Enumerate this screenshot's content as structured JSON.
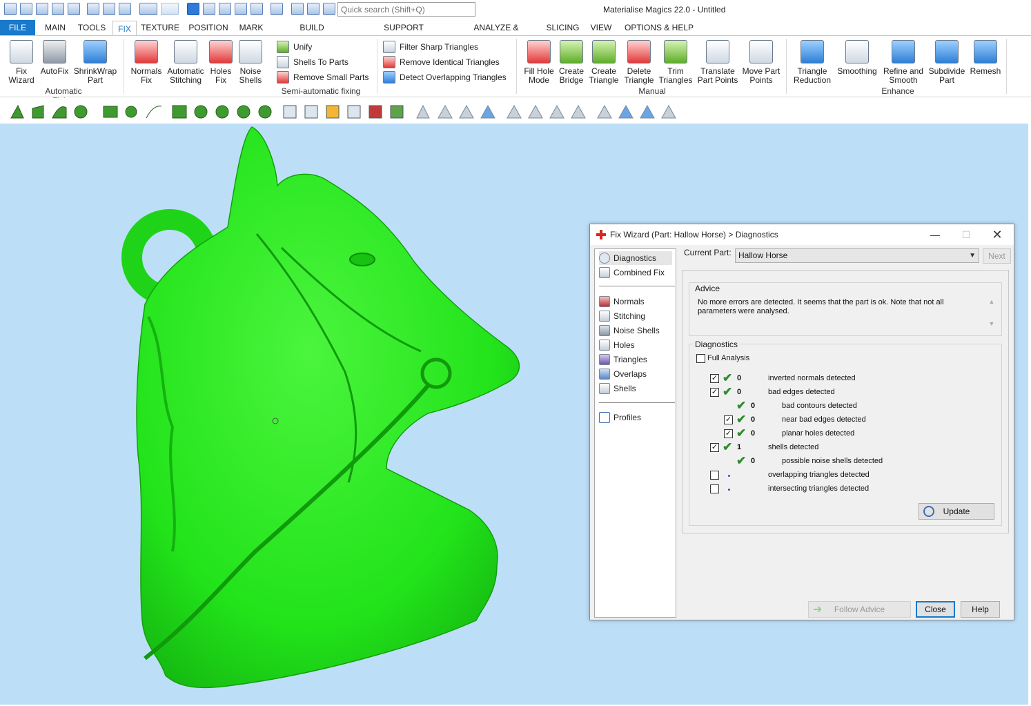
{
  "window": {
    "title": "Materialise Magics 22.0 - Untitled"
  },
  "quick_search": {
    "placeholder": "Quick search (Shift+Q)"
  },
  "menu": {
    "tabs": [
      "FILE",
      "MAIN",
      "TOOLS",
      "FIX",
      "TEXTURE",
      "POSITION",
      "MARK",
      "BUILD PREPARATION",
      "SUPPORT GENERATION",
      "ANALYZE & REPORT",
      "SLICING",
      "VIEW",
      "OPTIONS & HELP"
    ],
    "active": "FIX"
  },
  "ribbon": {
    "automatic_fixing": {
      "label": "Automatic Fixing",
      "buttons": [
        {
          "l1": "Fix",
          "l2": "Wizard",
          "icon": "fix-wizard-icon"
        },
        {
          "l1": "AutoFix",
          "l2": "",
          "icon": "autofix-icon"
        },
        {
          "l1": "ShrinkWrap",
          "l2": "Part",
          "icon": "shrinkwrap-icon"
        }
      ]
    },
    "semi_automatic_fixing": {
      "label": "Semi-automatic fixing",
      "buttons": [
        {
          "l1": "Normals",
          "l2": "Fix",
          "icon": "normals-fix-icon"
        },
        {
          "l1": "Automatic",
          "l2": "Stitching",
          "icon": "stitching-icon"
        },
        {
          "l1": "Holes",
          "l2": "Fix",
          "icon": "holes-fix-icon"
        },
        {
          "l1": "Noise",
          "l2": "Shells",
          "icon": "noise-shells-icon"
        }
      ],
      "small": [
        "Unify",
        "Shells To Parts",
        "Remove Small Parts"
      ],
      "small2": [
        "Filter Sharp Triangles",
        "Remove Identical Triangles",
        "Detect Overlapping Triangles"
      ]
    },
    "manual": {
      "label": "Manual",
      "buttons": [
        {
          "l1": "Fill Hole",
          "l2": "Mode",
          "icon": "fill-hole-icon"
        },
        {
          "l1": "Create",
          "l2": "Bridge",
          "icon": "create-bridge-icon"
        },
        {
          "l1": "Create",
          "l2": "Triangle",
          "icon": "create-triangle-icon"
        },
        {
          "l1": "Delete",
          "l2": "Triangle",
          "icon": "delete-triangle-icon"
        },
        {
          "l1": "Trim",
          "l2": "Triangles",
          "icon": "trim-triangles-icon"
        },
        {
          "l1": "Translate",
          "l2": "Part Points",
          "icon": "translate-points-icon"
        },
        {
          "l1": "Move Part",
          "l2": "Points",
          "icon": "move-points-icon"
        }
      ]
    },
    "enhance": {
      "label": "Enhance",
      "buttons": [
        {
          "l1": "Triangle",
          "l2": "Reduction",
          "icon": "triangle-reduction-icon"
        },
        {
          "l1": "Smoothing",
          "l2": "",
          "icon": "smoothing-icon"
        },
        {
          "l1": "Refine and",
          "l2": "Smooth",
          "icon": "refine-smooth-icon"
        },
        {
          "l1": "Subdivide",
          "l2": "Part",
          "icon": "subdivide-icon"
        },
        {
          "l1": "Remesh",
          "l2": "",
          "icon": "remesh-icon"
        }
      ]
    }
  },
  "dialog": {
    "title": "Fix Wizard (Part: Hallow Horse) > Diagnostics",
    "nav_top": [
      "Diagnostics",
      "Combined Fix"
    ],
    "nav_mid": [
      "Normals",
      "Stitching",
      "Noise Shells",
      "Holes",
      "Triangles",
      "Overlaps",
      "Shells"
    ],
    "nav_bottom": [
      "Profiles"
    ],
    "current_part_label": "Current Part:",
    "current_part": "Hallow Horse",
    "next": "Next",
    "advice_label": "Advice",
    "advice_text": "No more errors are detected. It seems that the part is ok. Note that not all parameters were analysed.",
    "diagnostics_label": "Diagnostics",
    "full_analysis": "Full Analysis",
    "rows": [
      {
        "count": "0",
        "label": "inverted normals detected"
      },
      {
        "count": "0",
        "label": "bad edges detected"
      },
      {
        "count": "0",
        "label": "bad contours detected"
      },
      {
        "count": "0",
        "label": "near bad edges detected"
      },
      {
        "count": "0",
        "label": "planar holes detected"
      },
      {
        "count": "1",
        "label": "shells detected"
      },
      {
        "count": "0",
        "label": "possible noise shells detected"
      },
      {
        "count": "",
        "label": "overlapping triangles detected"
      },
      {
        "count": "",
        "label": "intersecting triangles detected"
      }
    ],
    "update": "Update",
    "follow_advice": "Follow Advice",
    "close": "Close",
    "help": "Help"
  },
  "colors": {
    "accent": "#1979ca",
    "viewport_bg": "#bcdff7",
    "model": "#22e31a",
    "check": "#2f8a2f"
  }
}
